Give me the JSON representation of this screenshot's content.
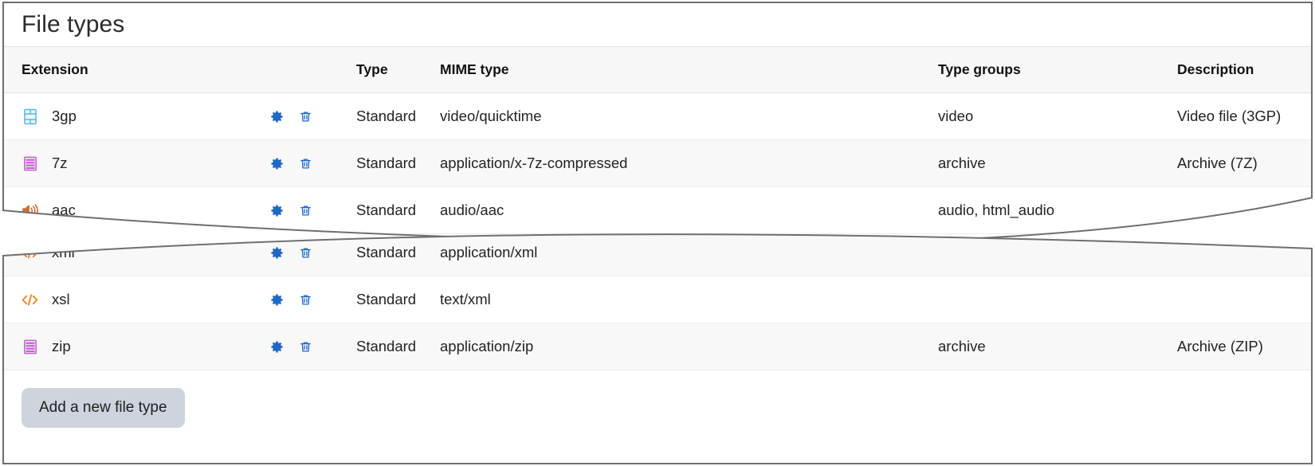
{
  "page": {
    "title": "File types"
  },
  "table": {
    "columns": [
      {
        "key": "extension",
        "label": "Extension"
      },
      {
        "key": "actions",
        "label": ""
      },
      {
        "key": "type",
        "label": "Type"
      },
      {
        "key": "mime",
        "label": "MIME type"
      },
      {
        "key": "groups",
        "label": "Type groups"
      },
      {
        "key": "description",
        "label": "Description"
      }
    ],
    "row_actions": {
      "edit_label": "Edit",
      "delete_label": "Delete",
      "edit_icon": "gear-icon",
      "delete_icon": "trash-icon"
    },
    "rows_top": [
      {
        "icon": "video-file-icon",
        "icon_color": "#5bb8ea",
        "extension": "3gp",
        "type": "Standard",
        "mime": "video/quicktime",
        "groups": "video",
        "description": "Video file (3GP)"
      },
      {
        "icon": "archive-file-icon",
        "icon_color": "#c15ed0",
        "extension": "7z",
        "type": "Standard",
        "mime": "application/x-7z-compressed",
        "groups": "archive",
        "description": "Archive (7Z)"
      },
      {
        "icon": "audio-file-icon",
        "icon_color": "#c97434",
        "extension": "aac",
        "type": "Standard",
        "mime": "audio/aac",
        "groups": "audio, html_audio",
        "description": ""
      }
    ],
    "rows_bottom": [
      {
        "icon": "code-file-icon",
        "icon_color": "#ef8632",
        "extension": "xml",
        "type": "Standard",
        "mime": "application/xml",
        "groups": "",
        "description": ""
      },
      {
        "icon": "code-file-icon",
        "icon_color": "#ef8632",
        "extension": "xsl",
        "type": "Standard",
        "mime": "text/xml",
        "groups": "",
        "description": ""
      },
      {
        "icon": "archive-file-icon",
        "icon_color": "#c15ed0",
        "extension": "zip",
        "type": "Standard",
        "mime": "application/zip",
        "groups": "archive",
        "description": "Archive (ZIP)"
      }
    ]
  },
  "footer": {
    "add_button_label": "Add a new file type"
  },
  "colors": {
    "action_icon": "#1f68c4",
    "header_background": "#f7f7f8",
    "row_alt_background": "#f8f8f9",
    "panel_border": "#6f6f70",
    "button_background": "#ced4dd",
    "text": "#222325"
  }
}
